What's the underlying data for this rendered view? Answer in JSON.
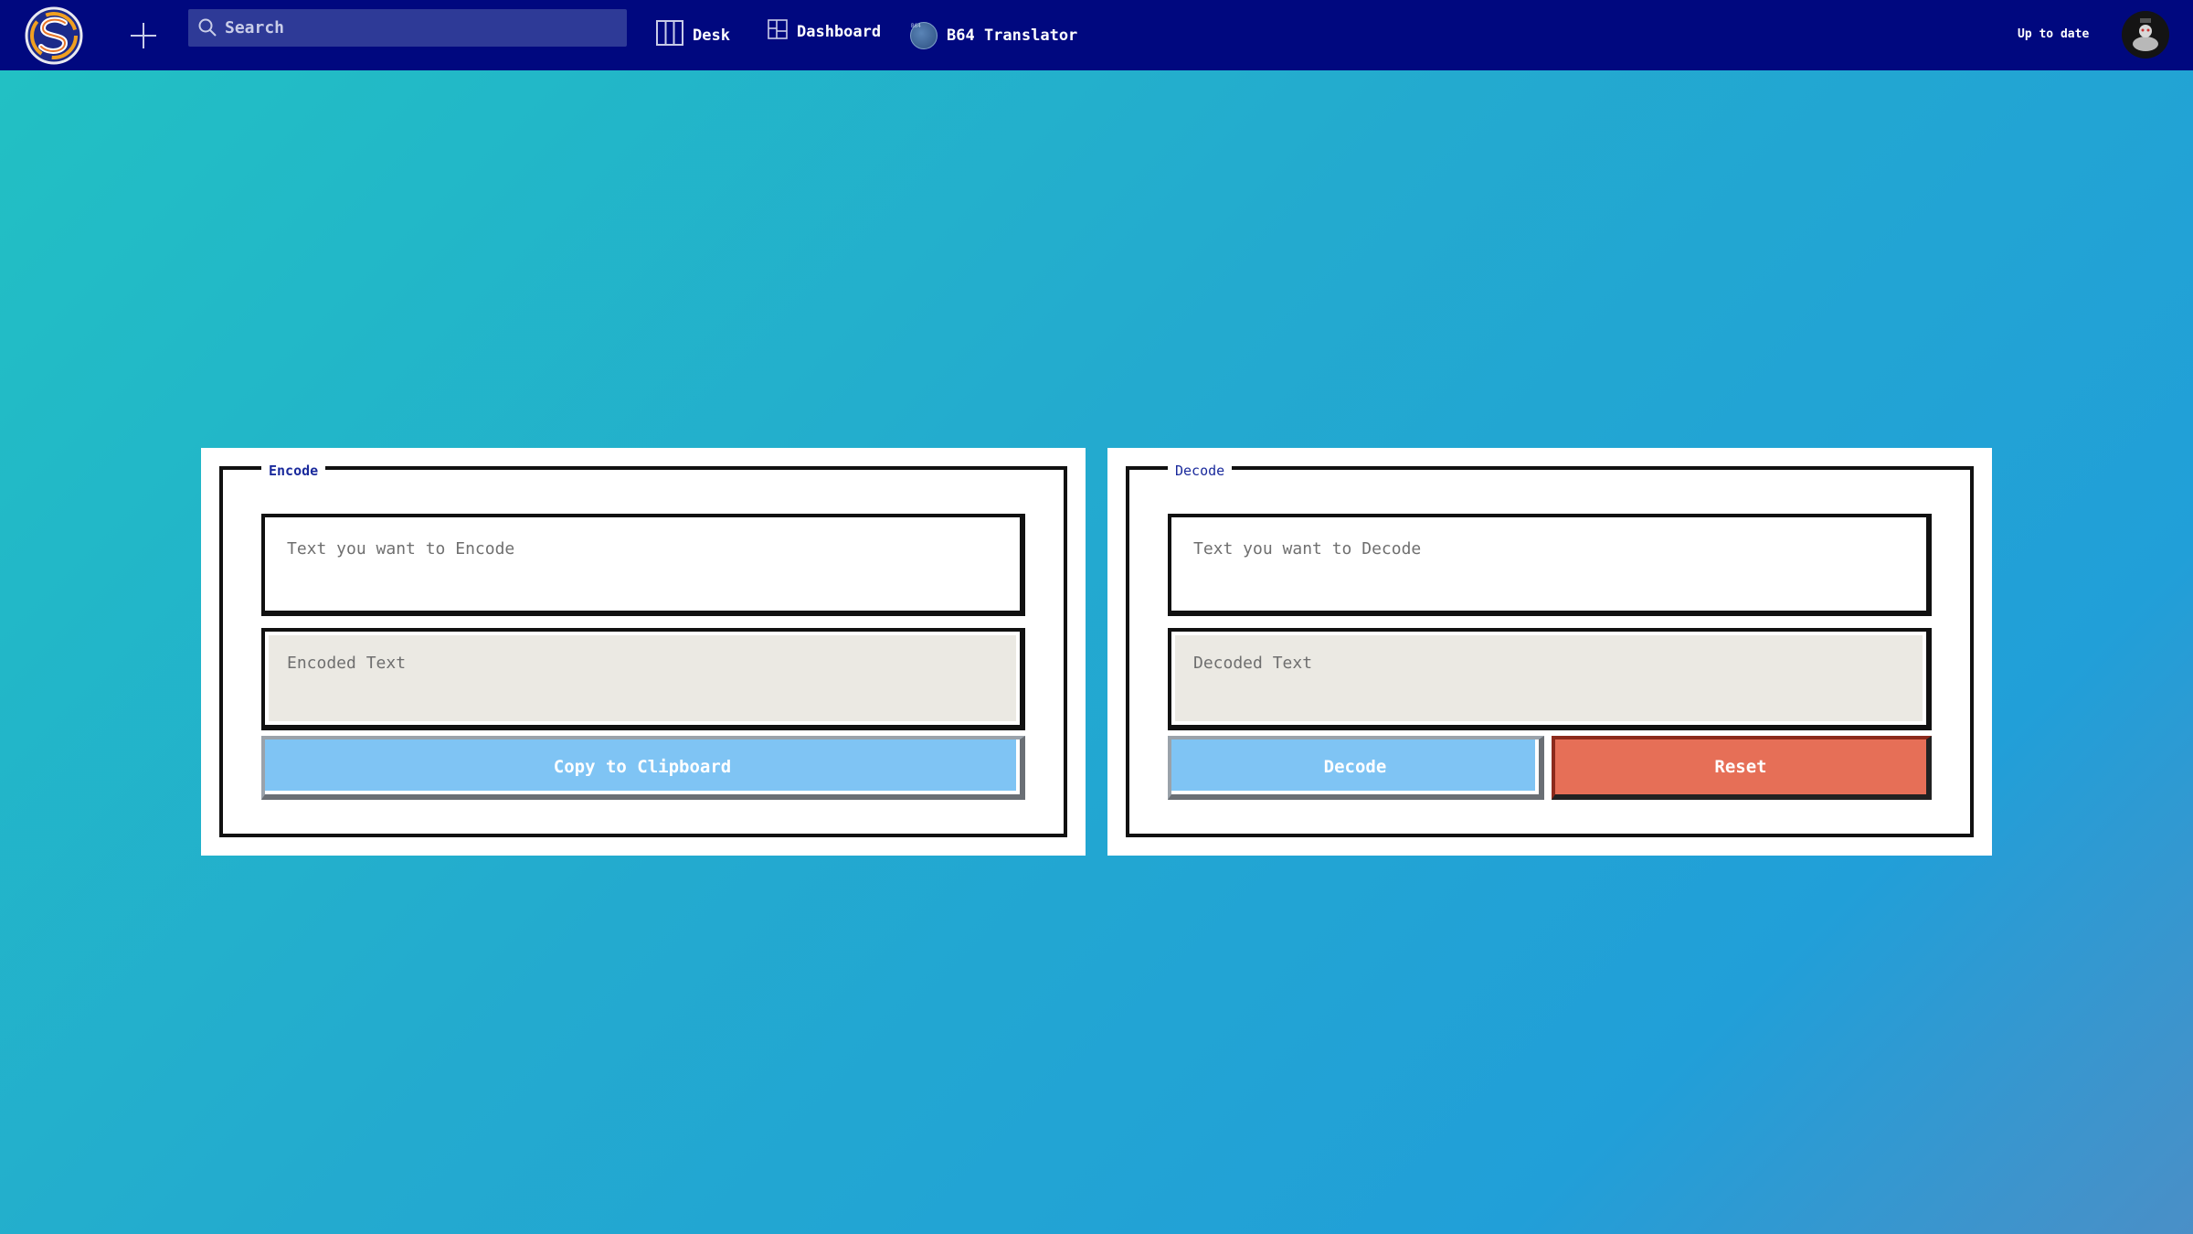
{
  "topbar": {
    "search_placeholder": "Search",
    "nav": {
      "desk": "Desk",
      "dashboard": "Dashboard",
      "b64_translator": "B64 Translator",
      "b64_icon_text": "B64"
    },
    "status": "Up to date",
    "colors": {
      "background": "#00087f",
      "search_bg": "#2e3a97"
    }
  },
  "encode": {
    "legend": "Encode",
    "input_placeholder": "Text you want to Encode",
    "output_placeholder": "Encoded Text",
    "copy_button": "Copy to Clipboard"
  },
  "decode": {
    "legend": "Decode",
    "input_placeholder": "Text you want to Decode",
    "output_placeholder": "Decoded Text",
    "decode_button": "Decode",
    "reset_button": "Reset"
  },
  "icons": {
    "logo": "app-logo-icon",
    "plus": "plus-icon",
    "search": "search-icon",
    "desk": "columns-icon",
    "dashboard": "dashboard-grid-icon",
    "avatar": "user-avatar"
  },
  "colors": {
    "button_blue": "#7fc4f4",
    "button_red": "#e66f57",
    "output_bg": "#ebe9e3"
  }
}
